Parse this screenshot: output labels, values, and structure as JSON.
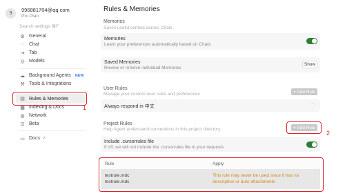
{
  "user": {
    "avatar_letter": "9",
    "email": "996881704@qq.com",
    "plan": "Pro Plan"
  },
  "search": {
    "placeholder": "Search settings ⌘F"
  },
  "sidebar": {
    "items": [
      {
        "label": "General",
        "icon": "gear-icon"
      },
      {
        "label": "Chat",
        "icon": "chat-icon"
      },
      {
        "label": "Tab",
        "icon": "tab-icon"
      },
      {
        "label": "Models",
        "icon": "models-icon"
      },
      {
        "label": "Background Agents",
        "icon": "cloud-icon",
        "badge": "NEW"
      },
      {
        "label": "Tools & Integrations",
        "icon": "tools-icon"
      },
      {
        "label": "Rules & Memories",
        "icon": "clipboard-icon",
        "active": true
      },
      {
        "label": "Indexing & Docs",
        "icon": "index-icon"
      },
      {
        "label": "Network",
        "icon": "globe-icon"
      },
      {
        "label": "Beta",
        "icon": "beta-icon"
      },
      {
        "label": "Docs",
        "icon": "docs-icon",
        "external": "↗"
      }
    ]
  },
  "main": {
    "title": "Rules & Memories",
    "memories": {
      "title": "Memories",
      "description": "Saves useful context across Chats",
      "toggle_card": {
        "title": "Memories",
        "description": "Learn your preferences automatically based on Chats",
        "enabled": true
      },
      "saved_card": {
        "title": "Saved Memories",
        "description": "Review or remove individual Memories",
        "button": "Show"
      }
    },
    "user_rules": {
      "title": "User Rules",
      "description": "Manage your custom user rules and preferences",
      "add_button": "+ Add Rule",
      "rule_text": "Always respond in 中文",
      "rule_menu": "···"
    },
    "project_rules": {
      "title": "Project Rules",
      "description": "Help Agent understand conventions in this project directory",
      "add_button": "+ Add Rule",
      "include_card": {
        "title": "Include .cursorrules file",
        "description": "If off, we will not include the .cursorrules file in your requests",
        "enabled": true
      },
      "table": {
        "headers": [
          "Rule",
          "Apply"
        ],
        "rows": [
          {
            "rules": [
              "testrule.mdc",
              "testrule.mdc"
            ],
            "apply": "This rule may never be used since it has no description or auto attachments"
          }
        ]
      }
    }
  },
  "annotations": {
    "one": "1",
    "two": "2"
  },
  "colors": {
    "accent_green": "#2e7d32",
    "annotation_red": "#d9262b",
    "warning_orange": "#d18a16",
    "badge_blue": "#3b82f6"
  }
}
